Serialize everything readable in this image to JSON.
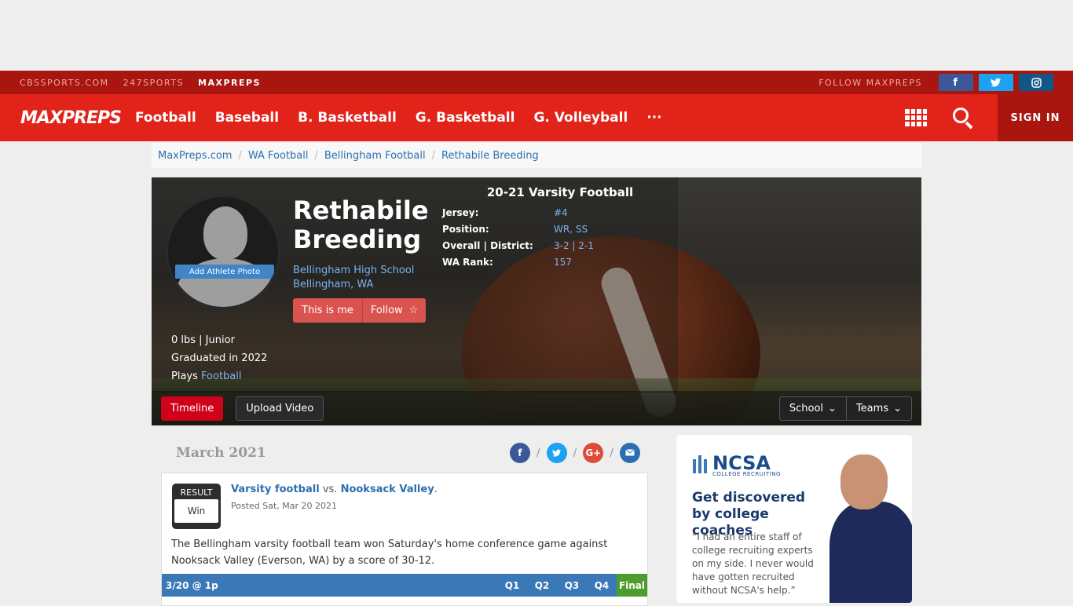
{
  "topbar": {
    "links": [
      "CBSSPORTS.COM",
      "247SPORTS",
      "MAXPREPS"
    ],
    "follow": "FOLLOW MAXPREPS",
    "social": {
      "facebook": "f",
      "twitter": "t",
      "instagram": "ig"
    }
  },
  "nav": {
    "logo": "MAXPREPS",
    "links": [
      "Football",
      "Baseball",
      "B. Basketball",
      "G. Basketball",
      "G. Volleyball",
      "···"
    ],
    "signin": "SIGN IN"
  },
  "breadcrumb": [
    "MaxPreps.com",
    "WA Football",
    "Bellingham Football",
    "Rethabile Breeding"
  ],
  "athlete": {
    "name": "Rethabile Breeding",
    "photo_button": "Add Athlete Photo",
    "school": "Bellingham High School",
    "location": "Bellingham, WA",
    "this_is_me": "This is me",
    "follow": "Follow",
    "weight_class": "0 lbs | Junior",
    "graduated": "Graduated in 2022",
    "plays_label": "Plays",
    "plays_sport": "Football"
  },
  "season": {
    "title": "20-21 Varsity Football",
    "rows": [
      {
        "label": "Jersey:",
        "value": "#4"
      },
      {
        "label": "Position:",
        "value": "WR, SS"
      },
      {
        "label": "Overall | District:",
        "value": "3-2 | 2-1"
      },
      {
        "label": "WA Rank:",
        "value": "157"
      }
    ]
  },
  "tabs": {
    "timeline": "Timeline",
    "upload": "Upload Video",
    "school": "School",
    "teams": "Teams"
  },
  "timeline": {
    "month": "March 2021",
    "share_sep": "/",
    "card": {
      "badge_top": "RESULT",
      "badge_bottom": "Win",
      "team": "Varsity football",
      "vs": "vs.",
      "opponent": "Nooksack Valley",
      "period": ".",
      "posted": "Posted Sat, Mar 20 2021",
      "description": "The Bellingham varsity football team won Saturday's home conference game against Nooksack Valley (Everson, WA) by a score of 30-12.",
      "score_date": "3/20 @ 1p",
      "quarters": [
        "Q1",
        "Q2",
        "Q3",
        "Q4"
      ],
      "final": "Final"
    }
  },
  "ad": {
    "brand": "NCSA",
    "brand_sub": "COLLEGE RECRUITING",
    "headline": "Get discovered by college coaches",
    "quote": "“I had an entire staff of college recruiting experts on my side. I never would have gotten recruited without NCSA's help.”"
  },
  "colors": {
    "brand_red": "#e2231a",
    "dark_red": "#a8160f",
    "link_blue": "#2c6fb0"
  }
}
